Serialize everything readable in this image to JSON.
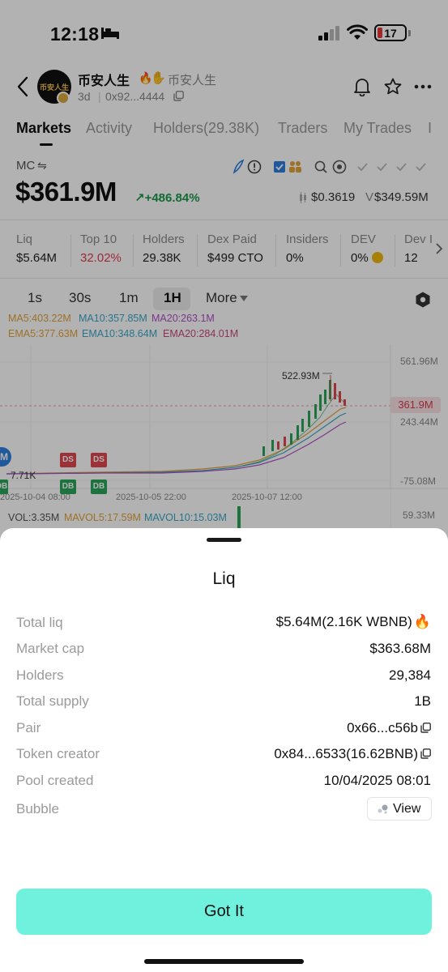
{
  "status_bar": {
    "time": "12:18",
    "battery": "17",
    "sleep_icon": "bed-icon",
    "signal_icon": "cellular-signal-icon",
    "wifi_icon": "wifi-icon"
  },
  "header": {
    "avatar_text": "币安人生",
    "token_name": "币安人生",
    "token_alias": "币安人生",
    "age": "3d",
    "address": "0x92...4444",
    "icons": [
      "back-icon",
      "flame-icon",
      "hand-icon",
      "copy-icon",
      "bell-icon",
      "star-icon",
      "more-icon"
    ]
  },
  "tabs": [
    {
      "label": "Markets",
      "active": true
    },
    {
      "label": "Activity",
      "active": false
    },
    {
      "label": "Holders(29.38K)",
      "active": false
    },
    {
      "label": "Traders",
      "active": false
    },
    {
      "label": "My Trades",
      "active": false
    },
    {
      "label": "I",
      "active": false
    }
  ],
  "market": {
    "mc_label": "MC",
    "mc_swap": "⇋",
    "mc_value": "$361.9M",
    "change": "↗+486.84%",
    "price": "$0.3619",
    "volume_prefix": "V",
    "volume": "$349.59M"
  },
  "stats": [
    {
      "label": "Liq",
      "value": "$5.64M"
    },
    {
      "label": "Top 10",
      "value": "32.02%",
      "color": "#e53950"
    },
    {
      "label": "Holders",
      "value": "29.38K"
    },
    {
      "label": "Dex Paid",
      "value": "$499 CTO"
    },
    {
      "label": "Insiders",
      "value": "0%"
    },
    {
      "label": "DEV",
      "value": "0%"
    },
    {
      "label": "Dev I",
      "value": "12"
    }
  ],
  "intervals": [
    {
      "label": "1s",
      "active": false
    },
    {
      "label": "30s",
      "active": false
    },
    {
      "label": "1m",
      "active": false
    },
    {
      "label": "1H",
      "active": true
    },
    {
      "label": "More",
      "active": false
    }
  ],
  "indicators": {
    "ma5": "MA5:403.22M",
    "ma10": "MA10:357.85M",
    "ma20": "MA20:263.1M",
    "ema5": "EMA5:377.63M",
    "ema10": "EMA10:348.64M",
    "ema20": "EMA20:284.01M",
    "vol": "VOL:3.35M",
    "mavol5": "MAVOL5:17.59M",
    "mavol10": "MAVOL10:15.03M",
    "colors": {
      "ma5": "#e0a23a",
      "ma10": "#3aa6c8",
      "ma20": "#b04fc4",
      "ema5": "#e0a23a",
      "ema10": "#3aa6c8",
      "ema20": "#c8487a"
    }
  },
  "chart": {
    "y_labels": [
      "561.96M",
      "243.44M",
      "-75.08M"
    ],
    "current_price_tag": "361.9M",
    "peak_label": "522.93M",
    "low_label": "7.71K",
    "x_labels": [
      "2025-10-04 08:00",
      "2025-10-05 22:00",
      "2025-10-07 12:00"
    ],
    "vol_axis": "59.33M",
    "markers": {
      "ds": "DS",
      "db": "DB",
      "m": "M"
    }
  },
  "sheet": {
    "title": "Liq",
    "rows": [
      {
        "label": "Total liq",
        "value": "$5.64M(2.16K WBNB)"
      },
      {
        "label": "Market cap",
        "value": "$363.68M"
      },
      {
        "label": "Holders",
        "value": "29,384"
      },
      {
        "label": "Total supply",
        "value": "1B"
      },
      {
        "label": "Pair",
        "value": "0x66...c56b"
      },
      {
        "label": "Token creator",
        "value": "0x84...6533(16.62BNB)"
      },
      {
        "label": "Pool created",
        "value": "10/04/2025 08:01"
      },
      {
        "label": "Bubble",
        "value": "View"
      }
    ],
    "button": "Got It"
  }
}
